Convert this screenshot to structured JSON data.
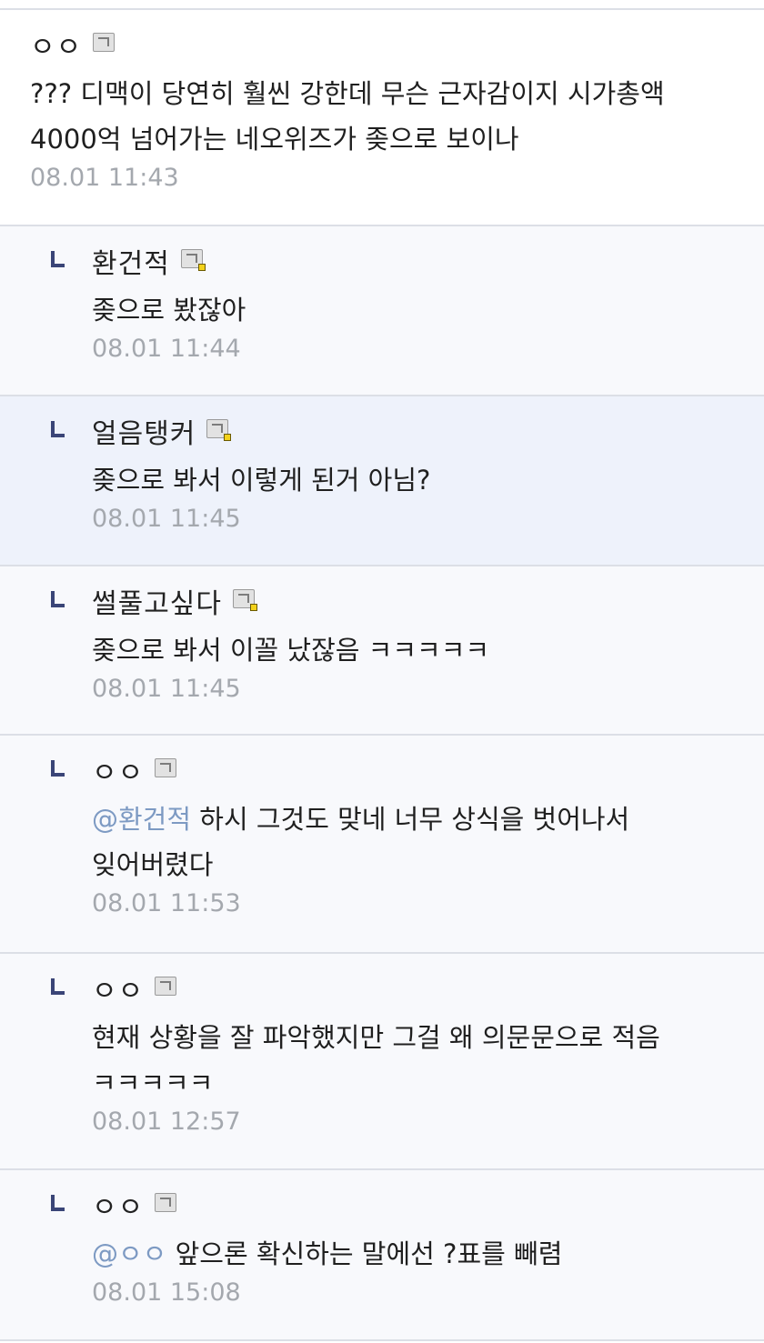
{
  "comments": [
    {
      "nick": "ㅇㅇ",
      "text": "??? 디맥이 당연히 훨씬 강한데 무슨 근자감이지 시가총액 4000억 넘어가는 네오위즈가 좆으로 보이나",
      "date": "08.01 11:43"
    },
    {
      "nick": "환건적",
      "text": "좆으로 봤잖아",
      "date": "08.01 11:44"
    },
    {
      "nick": "얼음탱커",
      "text": "좆으로 봐서 이렇게 된거 아님?",
      "date": "08.01 11:45"
    },
    {
      "nick": "썰풀고싶다",
      "text": "좆으로 봐서 이꼴 났잖음 ㅋㅋㅋㅋㅋ",
      "date": "08.01 11:45"
    },
    {
      "nick": "ㅇㅇ",
      "mention": "@환건적",
      "text": "하시 그것도 맞네 너무 상식을 벗어나서 잊어버렸다",
      "date": "08.01 11:53"
    },
    {
      "nick": "ㅇㅇ",
      "text": "현재 상황을 잘 파악했지만 그걸 왜 의문문으로 적음 ㅋㅋㅋㅋㅋ",
      "date": "08.01 12:57"
    },
    {
      "nick": "ㅇㅇ",
      "mention": "@ㅇㅇ",
      "text": "앞으론 확신하는 말에선 ?표를 빼렴",
      "date": "08.01 15:08"
    }
  ],
  "colors": {
    "mention": "#7d9ac3",
    "date": "#a4a8ae",
    "reply_mark": "#3a4577",
    "reply_bg": "#f8f9fc",
    "highlight_bg": "#eef2fb"
  }
}
